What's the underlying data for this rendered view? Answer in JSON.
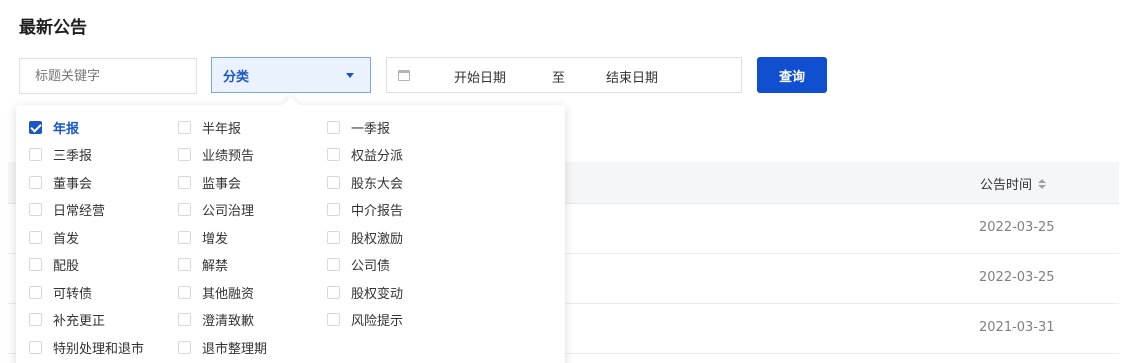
{
  "page": {
    "title": "最新公告"
  },
  "filters": {
    "keyword_placeholder": "标题关键字",
    "category_label": "分类",
    "date_start": "开始日期",
    "date_separator": "至",
    "date_end": "结束日期",
    "query_label": "查询"
  },
  "categories": [
    {
      "label": "年报",
      "checked": true
    },
    {
      "label": "半年报",
      "checked": false
    },
    {
      "label": "一季报",
      "checked": false
    },
    {
      "label": "三季报",
      "checked": false
    },
    {
      "label": "业绩预告",
      "checked": false
    },
    {
      "label": "权益分派",
      "checked": false
    },
    {
      "label": "董事会",
      "checked": false
    },
    {
      "label": "监事会",
      "checked": false
    },
    {
      "label": "股东大会",
      "checked": false
    },
    {
      "label": "日常经营",
      "checked": false
    },
    {
      "label": "公司治理",
      "checked": false
    },
    {
      "label": "中介报告",
      "checked": false
    },
    {
      "label": "首发",
      "checked": false
    },
    {
      "label": "增发",
      "checked": false
    },
    {
      "label": "股权激励",
      "checked": false
    },
    {
      "label": "配股",
      "checked": false
    },
    {
      "label": "解禁",
      "checked": false
    },
    {
      "label": "公司债",
      "checked": false
    },
    {
      "label": "可转债",
      "checked": false
    },
    {
      "label": "其他融资",
      "checked": false
    },
    {
      "label": "股权变动",
      "checked": false
    },
    {
      "label": "补充更正",
      "checked": false
    },
    {
      "label": "澄清致歉",
      "checked": false
    },
    {
      "label": "风险提示",
      "checked": false
    },
    {
      "label": "特别处理和退市",
      "checked": false
    },
    {
      "label": "退市整理期",
      "checked": false
    }
  ],
  "table": {
    "time_header": "公告时间",
    "rows": [
      {
        "date": "2022-03-25"
      },
      {
        "date": "2022-03-25"
      },
      {
        "date": "2021-03-31"
      }
    ]
  },
  "colors": {
    "accent": "#0f4fd0",
    "select_bg": "#eaf2fd"
  }
}
